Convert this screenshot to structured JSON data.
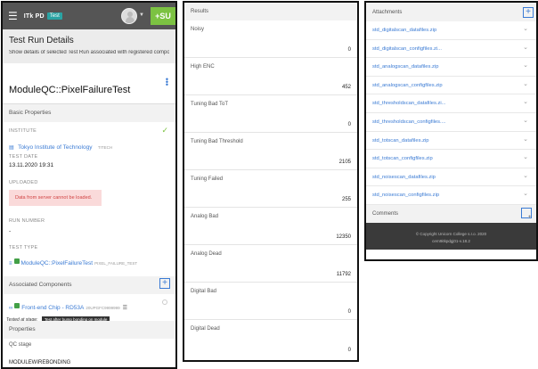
{
  "panel1": {
    "brand": "ITk PD",
    "env_badge": "Test",
    "su_button": "+SU",
    "header_title": "Test Run Details",
    "header_sub": "Show details of selected Test Run associated with registered compon...",
    "test_name": "ModuleQC::PixelFailureTest",
    "basic_properties": "Basic Properties",
    "institute_label": "INSTITUTE",
    "institute_value": "Tokyo Institute of Technology",
    "institute_code": "TITECH",
    "test_date_label": "TEST DATE",
    "test_date_value": "13.11.2020 19:31",
    "uploaded_label": "UPLOADED",
    "uploaded_error": "Data from server cannot be loaded.",
    "run_number_label": "RUN NUMBER",
    "run_number_value": "-",
    "test_type_label": "TEST TYPE",
    "test_type_value": "ModuleQC::PixelFailureTest",
    "test_type_code": "PIXEL_FAILURE_TEST",
    "associated_components": "Associated Components",
    "component_name": "Front-end Chip - RD53A",
    "component_serial": "20UPGFC9999999",
    "tested_at_stage": "Tested at stage:",
    "stage_tooltip": "Test after bump bonding on module",
    "properties": "Properties",
    "qc_stage_label": "QC stage",
    "qc_stage_value": "MODULEWIREBONDING"
  },
  "panel2": {
    "results_header": "Results",
    "results": [
      {
        "label": "Noisy",
        "value": "0"
      },
      {
        "label": "High ENC",
        "value": "452"
      },
      {
        "label": "Tuning Bad ToT",
        "value": "0"
      },
      {
        "label": "Tuning Bad Threshold",
        "value": "2105"
      },
      {
        "label": "Tuning Failed",
        "value": "255"
      },
      {
        "label": "Analog Bad",
        "value": "12350"
      },
      {
        "label": "Analog Dead",
        "value": "11792"
      },
      {
        "label": "Digital Bad",
        "value": "0"
      },
      {
        "label": "Digital Dead",
        "value": "0"
      }
    ]
  },
  "panel3": {
    "attachments_header": "Attachments",
    "attachments": [
      "std_digitalscan_datafiles.zip",
      "std_digitalscan_configfiles.zi...",
      "std_analogscan_datafiles.zip",
      "std_analogscan_configfiles.zip",
      "std_thresholdscan_datafiles.zi...",
      "std_thresholdscan_configfiles....",
      "std_totscan_datafiles.zip",
      "std_totscan_configfiles.zip",
      "std_noisescan_datafiles.zip",
      "std_noisescan_configfiles.zip"
    ],
    "comments_header": "Comments",
    "footer_copyright": "© Copyright Unicorn College s.r.o. 2020",
    "footer_version": "cern9itkpdgj01-v.18.2"
  },
  "colors": {
    "accent_green": "#7cc242",
    "link_blue": "#3b7bd4",
    "topbar": "#555555",
    "error_bg": "#fadada",
    "error_text": "#d14343"
  },
  "icons": [
    "menu-icon",
    "avatar-icon",
    "chevron-down-icon",
    "kebab-menu-icon",
    "check-icon",
    "institution-icon",
    "test-type-icon",
    "plus-icon",
    "chevron-right-icon"
  ]
}
